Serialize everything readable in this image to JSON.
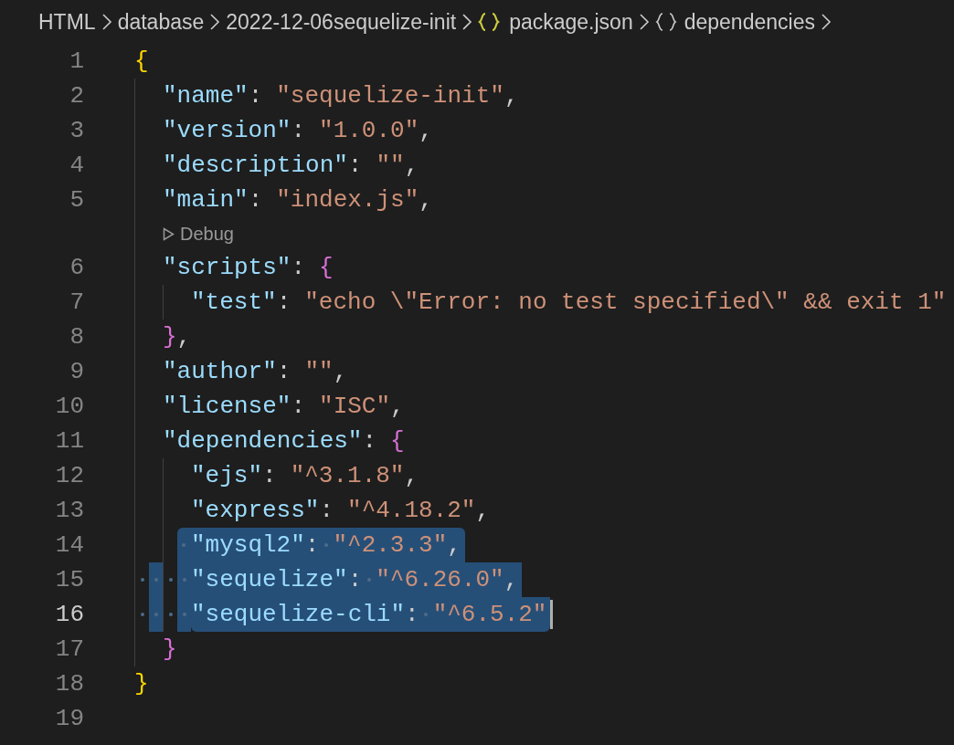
{
  "breadcrumb": [
    {
      "kind": "folder",
      "text": "HTML"
    },
    {
      "kind": "folder",
      "text": "database"
    },
    {
      "kind": "folder",
      "text": "2022-12-06sequelize-init"
    },
    {
      "kind": "file",
      "text": "package.json"
    },
    {
      "kind": "object",
      "text": "dependencies"
    }
  ],
  "lines": [
    {
      "number": "1",
      "selected": false,
      "current": false,
      "tokens": [
        {
          "kind": "open",
          "text": "{"
        }
      ]
    },
    {
      "number": "2",
      "selected": false,
      "current": false,
      "tokens": [
        {
          "kind": "key",
          "text": "\"name\""
        },
        {
          "kind": "colon",
          "text": ":"
        },
        {
          "kind": "string",
          "text": "\"sequelize-init\""
        },
        {
          "kind": "comma",
          "text": ","
        }
      ]
    },
    {
      "number": "3",
      "selected": false,
      "current": false,
      "tokens": [
        {
          "kind": "key",
          "text": "\"version\""
        },
        {
          "kind": "colon",
          "text": ":"
        },
        {
          "kind": "string",
          "text": "\"1.0.0\""
        },
        {
          "kind": "comma",
          "text": ","
        }
      ]
    },
    {
      "number": "4",
      "selected": false,
      "current": false,
      "tokens": [
        {
          "kind": "key",
          "text": "\"description\""
        },
        {
          "kind": "colon",
          "text": ":"
        },
        {
          "kind": "string",
          "text": "\"\""
        },
        {
          "kind": "comma",
          "text": ","
        }
      ]
    },
    {
      "number": "5",
      "selected": false,
      "current": false,
      "tokens": [
        {
          "kind": "key",
          "text": "\"main\""
        },
        {
          "kind": "colon",
          "text": ":"
        },
        {
          "kind": "string",
          "text": "\"index.js\""
        },
        {
          "kind": "comma",
          "text": ","
        }
      ]
    },
    {
      "kind": "codelens",
      "text": "Debug"
    },
    {
      "number": "6",
      "selected": false,
      "current": false,
      "tokens": [
        {
          "kind": "key",
          "text": "\"scripts\""
        },
        {
          "kind": "colon",
          "text": ":"
        },
        {
          "kind": "open",
          "text": "{"
        }
      ]
    },
    {
      "number": "7",
      "selected": false,
      "current": false,
      "tokens": [
        {
          "kind": "key",
          "text": "\"test\""
        },
        {
          "kind": "colon",
          "text": ":"
        },
        {
          "kind": "string",
          "text": "\"echo \\\"Error: no test specified\\\" && exit 1\""
        }
      ]
    },
    {
      "number": "8",
      "selected": false,
      "current": false,
      "tokens": [
        {
          "kind": "close",
          "text": "}"
        },
        {
          "kind": "comma",
          "text": ","
        }
      ]
    },
    {
      "number": "9",
      "selected": false,
      "current": false,
      "tokens": [
        {
          "kind": "key",
          "text": "\"author\""
        },
        {
          "kind": "colon",
          "text": ":"
        },
        {
          "kind": "string",
          "text": "\"\""
        },
        {
          "kind": "comma",
          "text": ","
        }
      ]
    },
    {
      "number": "10",
      "selected": false,
      "current": false,
      "tokens": [
        {
          "kind": "key",
          "text": "\"license\""
        },
        {
          "kind": "colon",
          "text": ":"
        },
        {
          "kind": "string",
          "text": "\"ISC\""
        },
        {
          "kind": "comma",
          "text": ","
        }
      ]
    },
    {
      "number": "11",
      "selected": false,
      "current": false,
      "tokens": [
        {
          "kind": "key",
          "text": "\"dependencies\""
        },
        {
          "kind": "colon",
          "text": ":"
        },
        {
          "kind": "open",
          "text": "{"
        }
      ]
    },
    {
      "number": "12",
      "selected": false,
      "current": false,
      "tokens": [
        {
          "kind": "key",
          "text": "\"ejs\""
        },
        {
          "kind": "colon",
          "text": ":"
        },
        {
          "kind": "string",
          "text": "\"^3.1.8\""
        },
        {
          "kind": "comma",
          "text": ","
        }
      ]
    },
    {
      "number": "13",
      "selected": false,
      "current": false,
      "tokens": [
        {
          "kind": "key",
          "text": "\"express\""
        },
        {
          "kind": "colon",
          "text": ":"
        },
        {
          "kind": "string",
          "text": "\"^4.18.2\""
        },
        {
          "kind": "comma",
          "text": ","
        }
      ]
    },
    {
      "number": "14",
      "selected": true,
      "current": false,
      "tokens": [
        {
          "kind": "key",
          "text": "\"mysql2\""
        },
        {
          "kind": "colon",
          "text": ":"
        },
        {
          "kind": "string",
          "text": "\"^2.3.3\""
        },
        {
          "kind": "comma",
          "text": ","
        }
      ]
    },
    {
      "number": "15",
      "selected": true,
      "current": false,
      "tokens": [
        {
          "kind": "key",
          "text": "\"sequelize\""
        },
        {
          "kind": "colon",
          "text": ":"
        },
        {
          "kind": "string",
          "text": "\"^6.26.0\""
        },
        {
          "kind": "comma",
          "text": ","
        }
      ]
    },
    {
      "number": "16",
      "selected": true,
      "current": true,
      "tokens": [
        {
          "kind": "key",
          "text": "\"sequelize-cli\""
        },
        {
          "kind": "colon",
          "text": ":"
        },
        {
          "kind": "string",
          "text": "\"^6.5.2\""
        }
      ]
    },
    {
      "number": "17",
      "selected": false,
      "current": false,
      "tokens": [
        {
          "kind": "close",
          "text": "}"
        }
      ]
    },
    {
      "number": "18",
      "selected": false,
      "current": false,
      "tokens": [
        {
          "kind": "close",
          "text": "}"
        }
      ]
    },
    {
      "number": "19",
      "selected": false,
      "current": false
    }
  ]
}
